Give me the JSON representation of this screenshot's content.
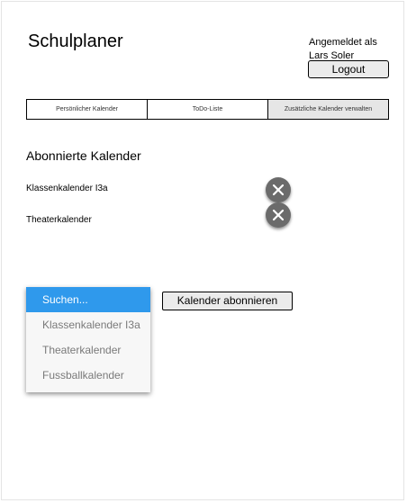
{
  "app": {
    "title": "Schulplaner"
  },
  "user": {
    "logged_in_label": "Angemeldet als Lars Soler",
    "logout_label": "Logout"
  },
  "tabs": [
    {
      "label": "Persönlicher Kalender",
      "active": false
    },
    {
      "label": "ToDo-Liste",
      "active": false
    },
    {
      "label": "Zusätzliche Kalender verwalten",
      "active": true
    }
  ],
  "subscribed": {
    "title": "Abonnierte Kalender",
    "items": [
      {
        "name": "Klassenkalender I3a",
        "remove_icon": "close-icon"
      },
      {
        "name": "Theaterkalender",
        "remove_icon": "close-icon"
      }
    ]
  },
  "dropdown": {
    "options": [
      {
        "label": "Suchen...",
        "selected": true
      },
      {
        "label": "Klassenkalender I3a",
        "selected": false
      },
      {
        "label": "Theaterkalender",
        "selected": false
      },
      {
        "label": "Fussballkalender",
        "selected": false
      }
    ],
    "selected_color": "#2f99ec"
  },
  "actions": {
    "subscribe_label": "Kalender abonnieren"
  }
}
